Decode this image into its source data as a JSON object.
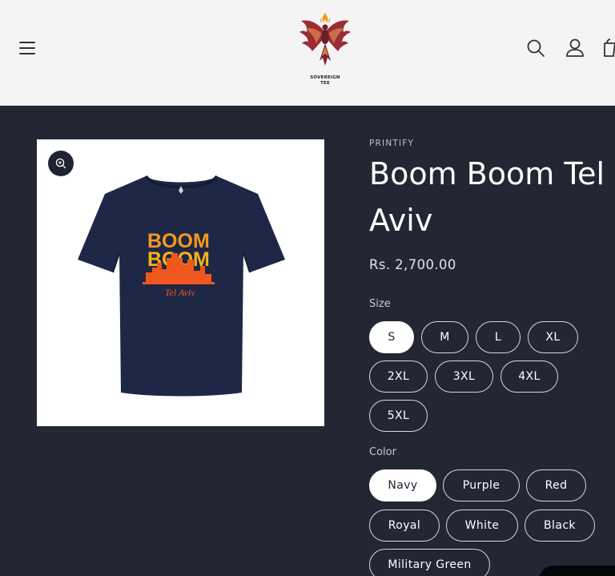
{
  "header": {
    "brand_line1": "SOVEREIGN",
    "brand_line2": "TEE",
    "icons": [
      "menu-icon",
      "search-icon",
      "account-icon",
      "cart-icon"
    ]
  },
  "media": {
    "shirt_text_line1": "BOOM",
    "shirt_text_line2": "BOOM",
    "shirt_text_line3": "Tel Aviv",
    "shirt_color": "#1f2747",
    "print_colors": [
      "#f6b21a",
      "#f0571c"
    ]
  },
  "product": {
    "vendor": "PRINTIFY",
    "title_line1": "Boom Boom Tel",
    "title_line2": "Aviv",
    "price": "Rs. 2,700.00"
  },
  "size": {
    "label": "Size",
    "options": [
      "S",
      "M",
      "L",
      "XL",
      "2XL",
      "3XL",
      "4XL",
      "5XL"
    ],
    "selected": "S"
  },
  "color": {
    "label": "Color",
    "options": [
      "Navy",
      "Purple",
      "Red",
      "Royal",
      "White",
      "Black",
      "Military Green"
    ],
    "selected": "Navy"
  },
  "theme": {
    "background": "#232633",
    "header_bg": "#f4f4f4",
    "selected_pill_bg": "#ffffff"
  }
}
